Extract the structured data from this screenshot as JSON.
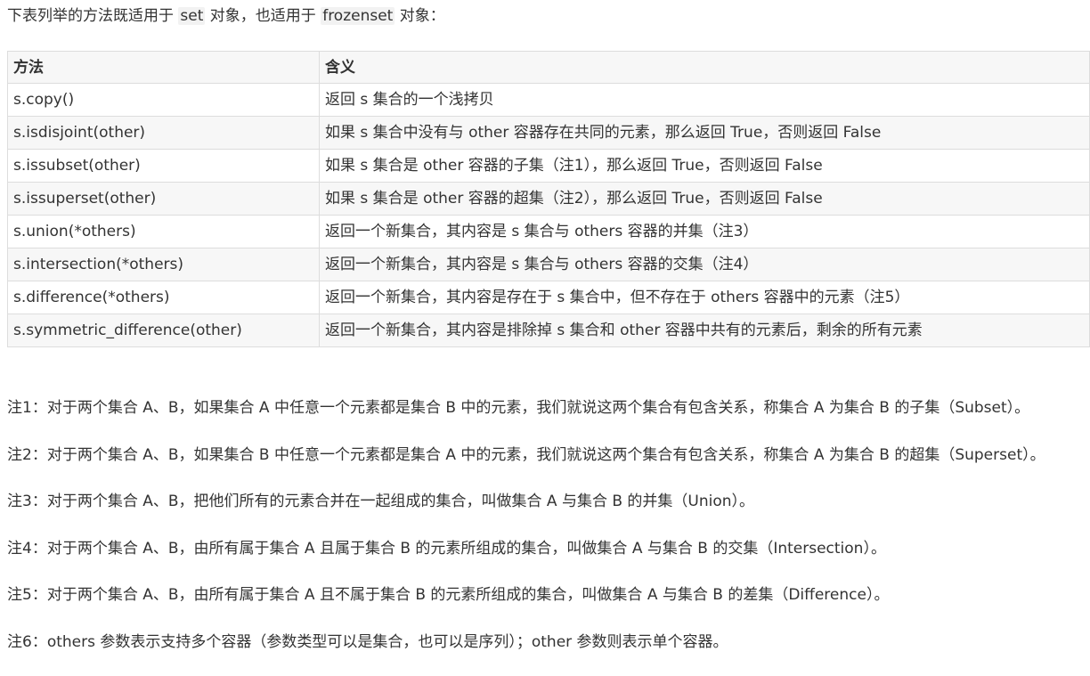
{
  "intro": {
    "prefix": "下表列举的方法既适用于 ",
    "set_code": "set",
    "middle": " 对象，也适用于 ",
    "frozenset_code": "frozenset",
    "suffix": " 对象："
  },
  "table": {
    "headers": [
      "方法",
      "含义"
    ],
    "rows": [
      [
        "s.copy()",
        "返回 s 集合的一个浅拷贝"
      ],
      [
        "s.isdisjoint(other)",
        "如果 s 集合中没有与 other 容器存在共同的元素，那么返回 True，否则返回 False"
      ],
      [
        "s.issubset(other)",
        "如果 s 集合是 other 容器的子集（注1），那么返回 True，否则返回 False"
      ],
      [
        "s.issuperset(other)",
        "如果 s 集合是 other 容器的超集（注2），那么返回 True，否则返回 False"
      ],
      [
        "s.union(*others)",
        "返回一个新集合，其内容是 s 集合与 others 容器的并集（注3）"
      ],
      [
        "s.intersection(*others)",
        "返回一个新集合，其内容是 s 集合与 others 容器的交集（注4）"
      ],
      [
        "s.difference(*others)",
        "返回一个新集合，其内容是存在于 s 集合中，但不存在于 others 容器中的元素（注5）"
      ],
      [
        "s.symmetric_difference(other)",
        "返回一个新集合，其内容是排除掉 s 集合和 other 容器中共有的元素后，剩余的所有元素"
      ]
    ]
  },
  "notes": [
    "注1：对于两个集合 A、B，如果集合 A 中任意一个元素都是集合 B 中的元素，我们就说这两个集合有包含关系，称集合 A 为集合 B 的子集（Subset）。",
    "注2：对于两个集合 A、B，如果集合 B 中任意一个元素都是集合 A 中的元素，我们就说这两个集合有包含关系，称集合 A 为集合 B 的超集（Superset）。",
    "注3：对于两个集合 A、B，把他们所有的元素合并在一起组成的集合，叫做集合 A 与集合 B 的并集（Union）。",
    "注4：对于两个集合 A、B，由所有属于集合 A 且属于集合 B 的元素所组成的集合，叫做集合 A 与集合 B 的交集（Intersection）。",
    "注5：对于两个集合 A、B，由所有属于集合 A 且不属于集合 B 的元素所组成的集合，叫做集合 A 与集合 B 的差集（Difference）。",
    "注6：others 参数表示支持多个容器（参数类型可以是集合，也可以是序列）；other 参数则表示单个容器。"
  ]
}
